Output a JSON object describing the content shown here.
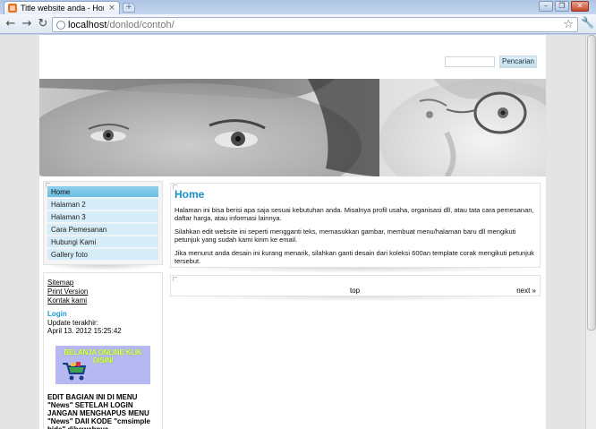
{
  "browser": {
    "tab_title": "Title website anda - Home",
    "tab_close": "×",
    "new_tab": "+",
    "url_host": "localhost",
    "url_path": "/donlod/contoh/",
    "back_icon": "arrow-left-icon",
    "forward_icon": "arrow-right-icon",
    "reload_icon": "reload-icon",
    "star_icon": "star-icon",
    "wrench_icon": "wrench-icon"
  },
  "search": {
    "button_label": "Pencarian",
    "input_value": ""
  },
  "menu": {
    "items": [
      {
        "label": "Home",
        "active": true
      },
      {
        "label": "Halaman 2"
      },
      {
        "label": "Halaman 3"
      },
      {
        "label": "Cara Pemesanan"
      },
      {
        "label": "Hubungi Kami"
      },
      {
        "label": "Gallery foto"
      }
    ]
  },
  "sidebar": {
    "links": [
      "Sitemap",
      "Print Version",
      "Kontak kami"
    ],
    "login_title": "Login",
    "update_label": "Update terakhir:",
    "update_value": "April 13. 2012 15:25:42",
    "banner_text": "BELANJA ONLINE KLIK DISINI",
    "warning": "EDIT BAGIAN INI DI MENU \"News\" SETELAH LOGIN\nJANGAN MENGHAPUS MENU \"News\" DAII KODE \"cmsimple hide\" dibawahnya"
  },
  "content": {
    "title": "Home",
    "paragraphs": [
      "Halaman ini bisa berisi apa saja sesuai kebutuhan anda. Misalnya profil usaha, organisasi dll, atau tata cara pemesanan, daftar harga, atau informasi lainnya.",
      "Silahkan edit website ini seperti mengganti teks, memasukkan gambar, membuat menu/halaman baru dll mengikuti petunjuk yang sudah kami kirim ke email.",
      "Jika menurut anda desain ini kurang menarik, silahkan ganti desain dari koleksi 600an template corak mengikuti petunjuk tersebut."
    ]
  },
  "footer": {
    "top_label": "top",
    "next_label": "next »"
  },
  "colors": {
    "accent": "#1a8fc8",
    "menu_bg": "#d6ecf7",
    "menu_active": "#79c4e6",
    "banner_bg": "#b6b8f2",
    "banner_text": "#e8ff4a"
  }
}
